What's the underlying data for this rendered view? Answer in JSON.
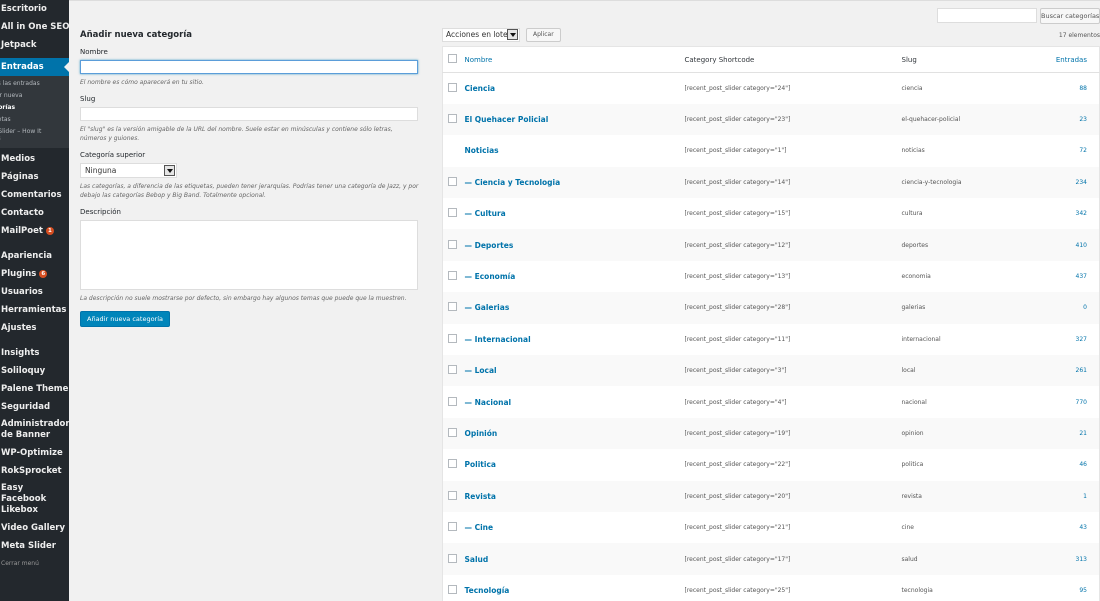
{
  "sidebar": {
    "top_items": [
      {
        "label": "Escritorio"
      },
      {
        "label": "All in One SEO"
      },
      {
        "label": "Jetpack"
      }
    ],
    "active_item": {
      "label": "Entradas"
    },
    "submenu": [
      {
        "label": "Todas las entradas",
        "shown": "as las entradas"
      },
      {
        "label": "Añadir nueva",
        "shown": "dir nueva"
      },
      {
        "label": "Categorías",
        "shown": "gorías"
      },
      {
        "label": "Etiquetas",
        "shown": "uetas"
      },
      {
        "label": "Post Slider – How It Works",
        "shown": "t Slider – How It\nks"
      }
    ],
    "bottom_items": [
      {
        "label": "Medios"
      },
      {
        "label": "Páginas"
      },
      {
        "label": "Comentarios"
      },
      {
        "label": "Contacto"
      },
      {
        "label": "MailPoet",
        "badge": "1"
      },
      {
        "label": "Apariencia"
      },
      {
        "label": "Plugins",
        "badge": "6"
      },
      {
        "label": "Usuarios"
      },
      {
        "label": "Herramientas"
      },
      {
        "label": "Ajustes"
      },
      {
        "label": "Insights"
      },
      {
        "label": "Soliloquy"
      },
      {
        "label": "Palene Theme"
      },
      {
        "label": "Seguridad"
      },
      {
        "label": "Administrador de Banner"
      },
      {
        "label": "WP-Optimize"
      },
      {
        "label": "RokSprocket"
      },
      {
        "label": "Easy Facebook Likebox"
      },
      {
        "label": "Video Gallery"
      },
      {
        "label": "Meta Slider"
      }
    ],
    "collapse_label": "Cerrar menú"
  },
  "search": {
    "placeholder": "",
    "button_label": "Buscar categorías"
  },
  "form": {
    "title": "Añadir nueva categoría",
    "name_label": "Nombre",
    "name_value": "",
    "name_help": "El nombre es cómo aparecerá en tu sitio.",
    "slug_label": "Slug",
    "slug_value": "",
    "slug_help": "El \"slug\" es la versión amigable de la URL del nombre. Suele estar en minúsculas y contiene sólo letras, números y guiones.",
    "parent_label": "Categoría superior",
    "parent_value": "Ninguna",
    "parent_help": "Las categorías, a diferencia de las etiquetas, pueden tener jerarquías. Podrías tener una categoría de Jazz, y por debajo las categorías Bebop y Big Band. Totalmente opcional.",
    "description_label": "Descripción",
    "description_value": "",
    "description_help": "La descripción no suele mostrarse por defecto, sin embargo hay algunos temas que puede que la muestren.",
    "submit_label": "Añadir nueva categoría"
  },
  "list": {
    "bulk_label": "Acciones en lote",
    "apply_label": "Aplicar",
    "items_count": "17 elementos",
    "columns": {
      "name": "Nombre",
      "shortcode": "Category Shortcode",
      "slug": "Slug",
      "count": "Entradas"
    },
    "rows": [
      {
        "name": "Ciencia",
        "shortcode": "[recent_post_slider category=\"24\"]",
        "slug": "ciencia",
        "count": "88",
        "checkbox": true
      },
      {
        "name": "El Quehacer Policial",
        "shortcode": "[recent_post_slider category=\"23\"]",
        "slug": "el-quehacer-policial",
        "count": "23",
        "checkbox": true
      },
      {
        "name": "Noticias",
        "shortcode": "[recent_post_slider category=\"1\"]",
        "slug": "noticias",
        "count": "72",
        "checkbox": false
      },
      {
        "name": "— Ciencia y Tecnologia",
        "shortcode": "[recent_post_slider category=\"14\"]",
        "slug": "ciencia-y-tecnologia",
        "count": "234",
        "checkbox": true
      },
      {
        "name": "— Cultura",
        "shortcode": "[recent_post_slider category=\"15\"]",
        "slug": "cultura",
        "count": "342",
        "checkbox": true
      },
      {
        "name": "— Deportes",
        "shortcode": "[recent_post_slider category=\"12\"]",
        "slug": "deportes",
        "count": "410",
        "checkbox": true
      },
      {
        "name": "— Economía",
        "shortcode": "[recent_post_slider category=\"13\"]",
        "slug": "economia",
        "count": "437",
        "checkbox": true
      },
      {
        "name": "— Galerias",
        "shortcode": "[recent_post_slider category=\"28\"]",
        "slug": "galerias",
        "count": "0",
        "checkbox": true
      },
      {
        "name": "— Internacional",
        "shortcode": "[recent_post_slider category=\"11\"]",
        "slug": "internacional",
        "count": "327",
        "checkbox": true
      },
      {
        "name": "— Local",
        "shortcode": "[recent_post_slider category=\"3\"]",
        "slug": "local",
        "count": "261",
        "checkbox": true
      },
      {
        "name": "— Nacional",
        "shortcode": "[recent_post_slider category=\"4\"]",
        "slug": "nacional",
        "count": "770",
        "checkbox": true
      },
      {
        "name": "Opinión",
        "shortcode": "[recent_post_slider category=\"19\"]",
        "slug": "opinion",
        "count": "21",
        "checkbox": true
      },
      {
        "name": "Politica",
        "shortcode": "[recent_post_slider category=\"22\"]",
        "slug": "politica",
        "count": "46",
        "checkbox": true
      },
      {
        "name": "Revista",
        "shortcode": "[recent_post_slider category=\"20\"]",
        "slug": "revista",
        "count": "1",
        "checkbox": true
      },
      {
        "name": "— Cine",
        "shortcode": "[recent_post_slider category=\"21\"]",
        "slug": "cine",
        "count": "43",
        "checkbox": true
      },
      {
        "name": "Salud",
        "shortcode": "[recent_post_slider category=\"17\"]",
        "slug": "salud",
        "count": "313",
        "checkbox": true
      },
      {
        "name": "Tecnología",
        "shortcode": "[recent_post_slider category=\"25\"]",
        "slug": "tecnologia",
        "count": "95",
        "checkbox": true
      }
    ]
  },
  "colors": {
    "sidebar_bg": "#23282d",
    "active_bg": "#0073aa",
    "link": "#0073aa",
    "primary_button": "#0085ba",
    "badge": "#d54e21"
  }
}
